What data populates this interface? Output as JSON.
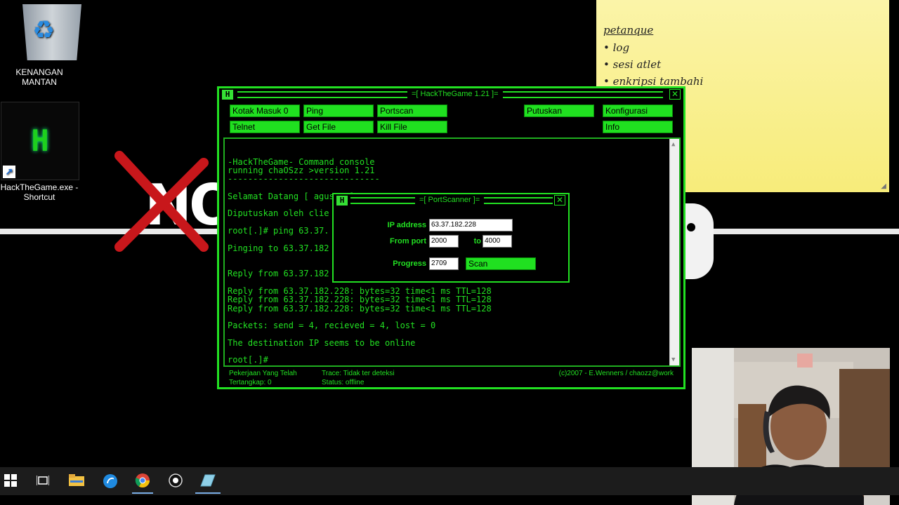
{
  "desktop": {
    "recycle_bin_label": "KENANGAN MANTAN",
    "shortcut_label_line1": "HackTheGame.exe -",
    "shortcut_label_line2": "Shortcut",
    "app_icon_letter": "H",
    "wallpaper_text": "NO G"
  },
  "sticky_note": {
    "title": "petanque",
    "items": [
      "• log",
      "• sesi atlet",
      "• enkripsi tambahi"
    ]
  },
  "main_window": {
    "title": "=[ HackTheGame 1.21 ]=",
    "icon_letter": "H",
    "close": "✕",
    "buttons": {
      "inbox": "Kotak Masuk 0",
      "ping": "Ping",
      "portscan": "Portscan",
      "disconnect": "Putuskan",
      "config": "Konfigurasi",
      "telnet": "Telnet",
      "getfile": "Get File",
      "killfile": "Kill File",
      "info": "Info"
    },
    "console_text": "-HackTheGame- Command console\nrunning chaOSzz >version 1.21\n------------------------------\n\nSelamat Datang [ agus12 ]\n\nDiputuskan oleh clie\n\nroot[.]# ping 63.37.\n\nPinging to 63.37.182\n\n\nReply from 63.37.182\n\nReply from 63.37.182.228: bytes=32 time<1 ms TTL=128\nReply from 63.37.182.228: bytes=32 time<1 ms TTL=128\nReply from 63.37.182.228: bytes=32 time<1 ms TTL=128\n\nPackets: send = 4, recieved = 4, lost = 0\n\nThe destination IP seems to be online\n\nroot[.]#",
    "footer": {
      "jobs_line1": "Pekerjaan Yang Telah",
      "jobs_line2": "Tertangkap: 0",
      "trace": "Trace: Tidak ter deteksi",
      "status": "Status: offline",
      "copyright": "(c)2007 - E.Wenners / chaozz@work"
    }
  },
  "port_scanner": {
    "title": "=[ PortScanner ]=",
    "icon_letter": "H",
    "close": "✕",
    "ip_label": "IP address",
    "ip_value": "63.37.182.228",
    "from_label": "From port",
    "from_value": "2000",
    "to_label": "to",
    "to_value": "4000",
    "progress_label": "Progress",
    "progress_value": "2709",
    "scan_button": "Scan"
  },
  "taskbar": {
    "apps": [
      "start-icon",
      "task-view-icon",
      "file-explorer-icon",
      "skype-icon",
      "chrome-icon",
      "steam-icon",
      "notes-icon"
    ]
  },
  "colors": {
    "accent_green": "#22e022",
    "sticky_yellow": "#f8ef85",
    "taskbar": "#1c1c1c"
  }
}
